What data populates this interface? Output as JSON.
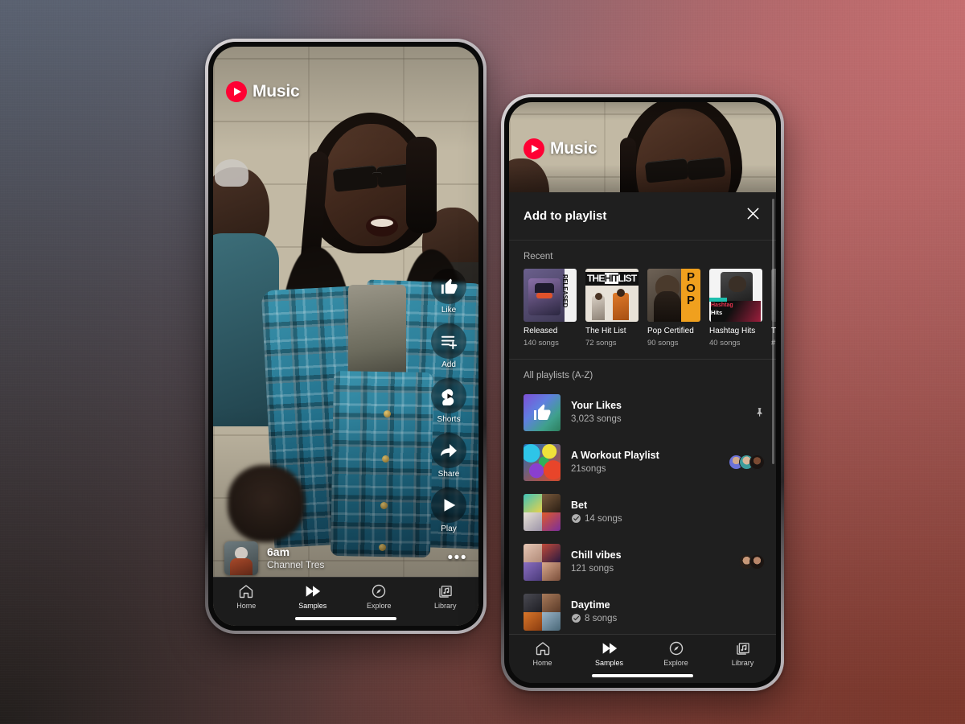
{
  "background": {
    "colors": {
      "top_left": "#5c6474",
      "top_right": "#c66e70",
      "bottom_left": "#221e1c",
      "bottom_right": "#7c382c"
    }
  },
  "brand": {
    "name": "Music",
    "accent": "#ff0033",
    "logo_icon": "youtube-music-play-icon"
  },
  "left_phone": {
    "video": {
      "actions": [
        {
          "id": "like",
          "label": "Like",
          "icon": "thumbs-up-icon"
        },
        {
          "id": "add",
          "label": "Add",
          "icon": "playlist-add-icon"
        },
        {
          "id": "shorts",
          "label": "Shorts",
          "icon": "shorts-icon"
        },
        {
          "id": "share",
          "label": "Share",
          "icon": "share-arrow-icon"
        },
        {
          "id": "play",
          "label": "Play",
          "icon": "play-triangle-icon"
        }
      ],
      "now_playing": {
        "title": "6am",
        "artist": "Channel Tres",
        "more_icon": "overflow-menu-icon",
        "thumbnail_icon": "album-art-thumbnail"
      }
    },
    "bottom_nav": [
      {
        "id": "home",
        "label": "Home",
        "icon": "home-icon",
        "active": false
      },
      {
        "id": "samples",
        "label": "Samples",
        "icon": "samples-icon",
        "active": true
      },
      {
        "id": "explore",
        "label": "Explore",
        "icon": "compass-icon",
        "active": false
      },
      {
        "id": "library",
        "label": "Library",
        "icon": "library-icon",
        "active": false
      }
    ]
  },
  "right_phone": {
    "sheet": {
      "title": "Add to playlist",
      "close_icon": "close-icon"
    },
    "recent": {
      "label": "Recent",
      "items": [
        {
          "name": "Released",
          "count": "140 songs",
          "art": "released-cover"
        },
        {
          "name": "The Hit List",
          "count": "72 songs",
          "art": "hit-list-cover"
        },
        {
          "name": "Pop Certified",
          "count": "90 songs",
          "art": "pop-certified-cover"
        },
        {
          "name": "Hashtag Hits",
          "count": "40 songs",
          "art": "hashtag-hits-cover"
        },
        {
          "name": "T",
          "count": "#",
          "art": "partial-cover"
        }
      ]
    },
    "all_playlists": {
      "label": "All playlists (A-Z)",
      "items": [
        {
          "title": "Your Likes",
          "count": "3,023 songs",
          "art": "thumbs-up-gradient",
          "badge": "",
          "trailing": "pin-icon",
          "avatars": 0
        },
        {
          "title": "A Workout Playlist",
          "count": "21songs",
          "art": "abstract-paint",
          "badge": "",
          "trailing": "avatars",
          "avatars": 3
        },
        {
          "title": "Bet",
          "count": "14 songs",
          "art": "mosaic-bet",
          "badge": "downloaded-icon",
          "trailing": "",
          "avatars": 0
        },
        {
          "title": "Chill vibes",
          "count": "121 songs",
          "art": "mosaic-chill",
          "badge": "",
          "trailing": "avatars",
          "avatars": 2
        },
        {
          "title": "Daytime",
          "count": "8 songs",
          "art": "mosaic-daytime",
          "badge": "downloaded-icon",
          "trailing": "",
          "avatars": 0
        }
      ]
    },
    "bottom_nav": [
      {
        "id": "home",
        "label": "Home",
        "icon": "home-icon",
        "active": false
      },
      {
        "id": "samples",
        "label": "Samples",
        "icon": "samples-icon",
        "active": true
      },
      {
        "id": "explore",
        "label": "Explore",
        "icon": "compass-icon",
        "active": false
      },
      {
        "id": "library",
        "label": "Library",
        "icon": "library-icon",
        "active": false
      }
    ]
  }
}
